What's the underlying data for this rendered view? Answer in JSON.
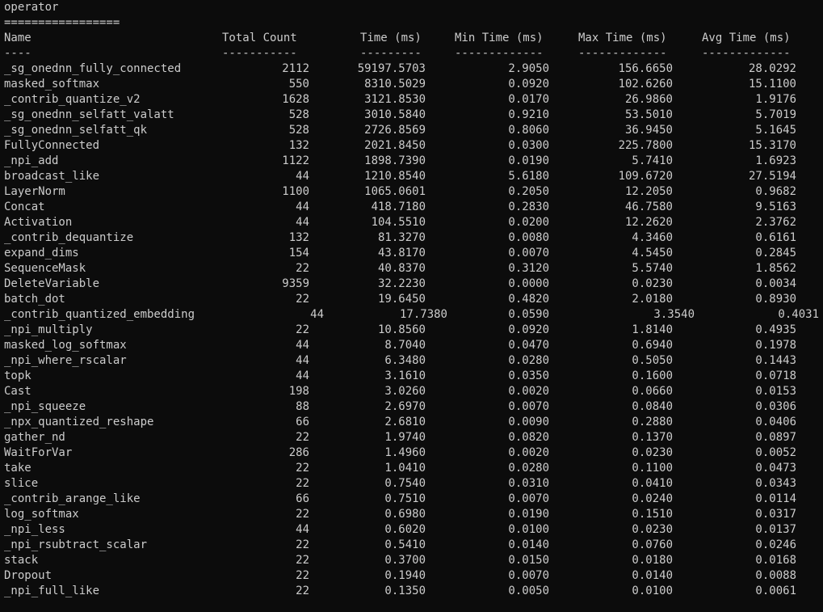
{
  "section_title": "operator",
  "section_underline": "=================",
  "headers": [
    "Name",
    "Total Count",
    "Time (ms)",
    "Min Time (ms)",
    "Max Time (ms)",
    "Avg Time (ms)"
  ],
  "header_underlines": [
    "----",
    "-----------",
    "---------",
    "-------------",
    "-------------",
    "-------------"
  ],
  "rows": [
    [
      "_sg_onednn_fully_connected",
      "2112",
      "59197.5703",
      "2.9050",
      "156.6650",
      "28.0292"
    ],
    [
      "masked_softmax",
      "550",
      "8310.5029",
      "0.0920",
      "102.6260",
      "15.1100"
    ],
    [
      "_contrib_quantize_v2",
      "1628",
      "3121.8530",
      "0.0170",
      "26.9860",
      "1.9176"
    ],
    [
      "_sg_onednn_selfatt_valatt",
      "528",
      "3010.5840",
      "0.9210",
      "53.5010",
      "5.7019"
    ],
    [
      "_sg_onednn_selfatt_qk",
      "528",
      "2726.8569",
      "0.8060",
      "36.9450",
      "5.1645"
    ],
    [
      "FullyConnected",
      "132",
      "2021.8450",
      "0.0300",
      "225.7800",
      "15.3170"
    ],
    [
      "_npi_add",
      "1122",
      "1898.7390",
      "0.0190",
      "5.7410",
      "1.6923"
    ],
    [
      "broadcast_like",
      "44",
      "1210.8540",
      "5.6180",
      "109.6720",
      "27.5194"
    ],
    [
      "LayerNorm",
      "1100",
      "1065.0601",
      "0.2050",
      "12.2050",
      "0.9682"
    ],
    [
      "Concat",
      "44",
      "418.7180",
      "0.2830",
      "46.7580",
      "9.5163"
    ],
    [
      "Activation",
      "44",
      "104.5510",
      "0.0200",
      "12.2620",
      "2.3762"
    ],
    [
      "_contrib_dequantize",
      "132",
      "81.3270",
      "0.0080",
      "4.3460",
      "0.6161"
    ],
    [
      "expand_dims",
      "154",
      "43.8170",
      "0.0070",
      "4.5450",
      "0.2845"
    ],
    [
      "SequenceMask",
      "22",
      "40.8370",
      "0.3120",
      "5.5740",
      "1.8562"
    ],
    [
      "DeleteVariable",
      "9359",
      "32.2230",
      "0.0000",
      "0.0230",
      "0.0034"
    ],
    [
      "batch_dot",
      "22",
      "19.6450",
      "0.4820",
      "2.0180",
      "0.8930"
    ],
    [
      "_contrib_quantized_embedding",
      "44",
      "17.7380",
      "0.0590",
      "3.3540",
      "0.4031"
    ],
    [
      "_npi_multiply",
      "22",
      "10.8560",
      "0.0920",
      "1.8140",
      "0.4935"
    ],
    [
      "masked_log_softmax",
      "44",
      "8.7040",
      "0.0470",
      "0.6940",
      "0.1978"
    ],
    [
      "_npi_where_rscalar",
      "44",
      "6.3480",
      "0.0280",
      "0.5050",
      "0.1443"
    ],
    [
      "topk",
      "44",
      "3.1610",
      "0.0350",
      "0.1600",
      "0.0718"
    ],
    [
      "Cast",
      "198",
      "3.0260",
      "0.0020",
      "0.0660",
      "0.0153"
    ],
    [
      "_npi_squeeze",
      "88",
      "2.6970",
      "0.0070",
      "0.0840",
      "0.0306"
    ],
    [
      "_npx_quantized_reshape",
      "66",
      "2.6810",
      "0.0090",
      "0.2880",
      "0.0406"
    ],
    [
      "gather_nd",
      "22",
      "1.9740",
      "0.0820",
      "0.1370",
      "0.0897"
    ],
    [
      "WaitForVar",
      "286",
      "1.4960",
      "0.0020",
      "0.0230",
      "0.0052"
    ],
    [
      "take",
      "22",
      "1.0410",
      "0.0280",
      "0.1100",
      "0.0473"
    ],
    [
      "slice",
      "22",
      "0.7540",
      "0.0310",
      "0.0410",
      "0.0343"
    ],
    [
      "_contrib_arange_like",
      "66",
      "0.7510",
      "0.0070",
      "0.0240",
      "0.0114"
    ],
    [
      "log_softmax",
      "22",
      "0.6980",
      "0.0190",
      "0.1510",
      "0.0317"
    ],
    [
      "_npi_less",
      "44",
      "0.6020",
      "0.0100",
      "0.0230",
      "0.0137"
    ],
    [
      "_npi_rsubtract_scalar",
      "22",
      "0.5410",
      "0.0140",
      "0.0760",
      "0.0246"
    ],
    [
      "stack",
      "22",
      "0.3700",
      "0.0150",
      "0.0180",
      "0.0168"
    ],
    [
      "Dropout",
      "22",
      "0.1940",
      "0.0070",
      "0.0140",
      "0.0088"
    ],
    [
      "_npi_full_like",
      "22",
      "0.1350",
      "0.0050",
      "0.0100",
      "0.0061"
    ]
  ]
}
